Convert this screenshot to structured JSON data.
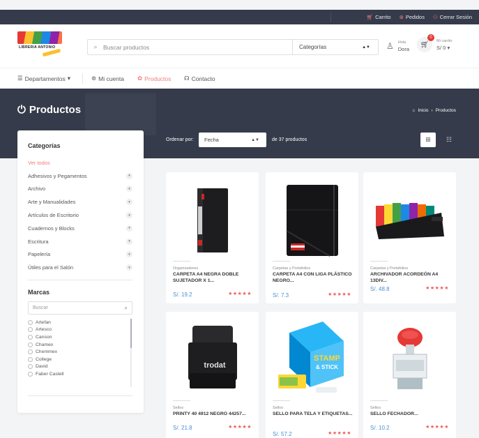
{
  "topbar": {
    "links": [
      {
        "icon": "cart-icon",
        "label": "Carrito"
      },
      {
        "icon": "orders-icon",
        "label": "Pedidos"
      },
      {
        "icon": "user-icon",
        "label": "Cerrar Sesión"
      }
    ]
  },
  "header": {
    "logo_text": "LIBRERIA ANTONIO",
    "search_placeholder": "Buscar productos",
    "categories_select": "Categorías",
    "user_greeting": "Hola",
    "user_name": "Dora",
    "cart_label": "Mi carrito",
    "cart_total": "S/ 0",
    "cart_count": "0"
  },
  "nav": {
    "departments": "Departamentos",
    "account": "Mi cuenta",
    "products": "Productos",
    "contact": "Contacto"
  },
  "banner": {
    "title": "Productos",
    "breadcrumb_home": "Inicio",
    "breadcrumb_current": "Productos"
  },
  "toolbar": {
    "sort_label": "Ordenar por:",
    "sort_value": "Fecha",
    "count_text": "de 37 productos"
  },
  "sidebar": {
    "categories_title": "Categorías",
    "categories": [
      "Ver todos",
      "Adhesivos y Pegamentos",
      "Archivo",
      "Arte y Manualidades",
      "Artículos de Escritorio",
      "Cuadernos y Blocks",
      "Escritura",
      "Papelería",
      "Útiles para el Salón"
    ],
    "brands_title": "Marcas",
    "brands_search_placeholder": "Buscar",
    "brands": [
      "Artefan",
      "Artesco",
      "Canson",
      "Chamex",
      "Chemmex",
      "College",
      "David",
      "Faber Castell"
    ]
  },
  "products": [
    {
      "category": "Organizadores",
      "name": "CARPETA A4 NEGRA DOBLE SUJETADOR X 1...",
      "price": "S/. 19.2",
      "rating": "★★★★★",
      "image": "black-folder"
    },
    {
      "category": "Carpetas y Portafolios",
      "name": "CARPETA A4 CON LIGA PLÁSTICO NEGRO...",
      "price": "S/. 7.3",
      "rating": "★★★★★",
      "image": "elastic-folder"
    },
    {
      "category": "Carpetas y Portafolios",
      "name": "ARCHIVADOR ACORDEÓN A4 13DIV...",
      "price": "S/. 48.8",
      "rating": "★★★★★",
      "image": "accordion-file"
    },
    {
      "category": "Sellos",
      "name": "PRINTY 40 4912 NEGRO 44257...",
      "price": "S/. 21.8",
      "rating": "★★★★★",
      "image": "stamp"
    },
    {
      "category": "Sellos",
      "name": "SELLO PARA TELA Y ETIQUETAS...",
      "price": "S/. 57.2",
      "rating": "★★★★★",
      "image": "stamp-stick"
    },
    {
      "category": "Sellos",
      "name": "SELLO FECHADOR...",
      "price": "S/. 10.2",
      "rating": "★★★★★",
      "image": "date-stamp"
    }
  ],
  "product_labels": {
    "stamp_brand": "trodat",
    "stamp_stick_1": "STAMP",
    "stamp_stick_2": "& STICK"
  }
}
